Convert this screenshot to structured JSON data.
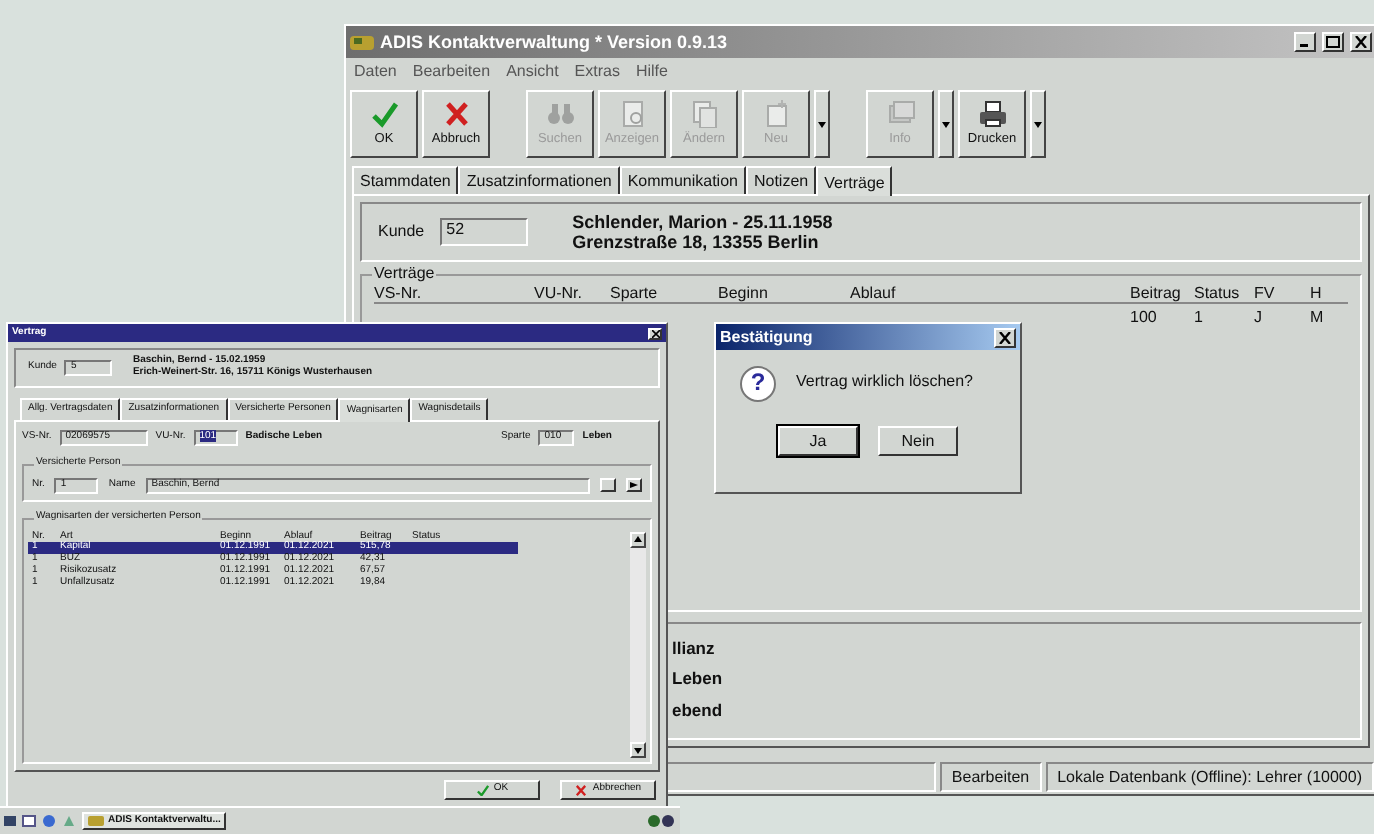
{
  "main_window": {
    "title": "ADIS Kontaktverwaltung * Version 0.9.13",
    "menu": [
      "Daten",
      "Bearbeiten",
      "Ansicht",
      "Extras",
      "Hilfe"
    ],
    "toolbar": [
      {
        "kind": "ok",
        "label": "OK",
        "disabled": false,
        "dropdown": false
      },
      {
        "kind": "cancel",
        "label": "Abbruch",
        "disabled": false,
        "dropdown": false
      },
      {
        "kind": "search",
        "label": "Suchen",
        "disabled": true,
        "dropdown": false
      },
      {
        "kind": "view",
        "label": "Anzeigen",
        "disabled": true,
        "dropdown": false
      },
      {
        "kind": "edit",
        "label": "Ändern",
        "disabled": true,
        "dropdown": false
      },
      {
        "kind": "new",
        "label": "Neu",
        "disabled": true,
        "dropdown": true
      },
      {
        "kind": "info",
        "label": "Info",
        "disabled": true,
        "dropdown": true
      },
      {
        "kind": "print",
        "label": "Drucken",
        "disabled": false,
        "dropdown": true
      }
    ],
    "tabs": [
      {
        "label": "Stammdaten",
        "selected": false
      },
      {
        "label": "Zusatzinformationen",
        "selected": false
      },
      {
        "label": "Kommunikation",
        "selected": false
      },
      {
        "label": "Notizen",
        "selected": false
      },
      {
        "label": "Verträge",
        "selected": true
      }
    ],
    "customer": {
      "label": "Kunde",
      "number": "52",
      "name_line": "Schlender, Marion - 25.11.1958",
      "address_line": "Grenzstraße 18, 13355 Berlin"
    },
    "contracts": {
      "title": "Verträge",
      "columns": [
        "VS-Nr.",
        "VU-Nr.",
        "Sparte",
        "Beginn",
        "Ablauf",
        "Beitrag",
        "Status",
        "FV",
        "H"
      ],
      "rows": [
        {
          "visible_cells": [
            "100",
            "1",
            "J",
            "M"
          ]
        }
      ]
    },
    "lower_panel": {
      "lines": [
        "llianz",
        "Leben",
        "ebend"
      ]
    },
    "status_bar": [
      "Bearbeiten",
      "Lokale Datenbank (Offline): Lehrer (10000)"
    ]
  },
  "contract_window": {
    "title": "Vertrag",
    "customer": {
      "label": "Kunde",
      "number": "5",
      "name_line": "Baschin, Bernd - 15.02.1959",
      "address_line": "Erich-Weinert-Str. 16, 15711 Königs Wusterhausen"
    },
    "tabs": [
      {
        "label": "Allg. Vertragsdaten",
        "selected": false
      },
      {
        "label": "Zusatzinformationen",
        "selected": false
      },
      {
        "label": "Versicherte Personen",
        "selected": false
      },
      {
        "label": "Wagnisarten",
        "selected": true
      },
      {
        "label": "Wagnisdetails",
        "selected": false
      }
    ],
    "fields": [
      {
        "label": "VS-Nr.",
        "value": "02069575",
        "text_selected": false
      },
      {
        "label": "VU-Nr.",
        "value": "101",
        "text_selected": true
      }
    ],
    "company": "Badische Leben",
    "branch": {
      "label": "Sparte",
      "value": "010",
      "name": "Leben"
    },
    "insured_person": {
      "title": "Versicherte Person",
      "number_label": "Nr.",
      "number": "1",
      "name_label": "Name",
      "name": "Baschin, Bernd"
    },
    "risks": {
      "title": "Wagnisarten der versicherten Person",
      "columns": [
        "Nr.",
        "Art",
        "Beginn",
        "Ablauf",
        "Beitrag",
        "Status"
      ],
      "rows": [
        {
          "cells": [
            "1",
            "Kapital",
            "01.12.1991",
            "01.12.2021",
            "515,78"
          ],
          "selected": true
        },
        {
          "cells": [
            "1",
            "BUZ",
            "01.12.1991",
            "01.12.2021",
            "42,31"
          ],
          "selected": false
        },
        {
          "cells": [
            "1",
            "Risikozusatz",
            "01.12.1991",
            "01.12.2021",
            "67,57"
          ],
          "selected": false
        },
        {
          "cells": [
            "1",
            "Unfallzusatz",
            "01.12.1991",
            "01.12.2021",
            "19,84"
          ],
          "selected": false
        }
      ]
    },
    "buttons": [
      {
        "kind": "ok",
        "label": "OK"
      },
      {
        "kind": "cancel",
        "label": "Abbrechen"
      }
    ]
  },
  "dialog": {
    "title": "Bestätigung",
    "icon": "?",
    "message": "Vertrag wirklich löschen?",
    "buttons": [
      {
        "label": "Ja",
        "default": true
      },
      {
        "label": "Nein",
        "default": false
      }
    ]
  },
  "taskbar": {
    "task": "ADIS Kontaktverwaltu..."
  }
}
